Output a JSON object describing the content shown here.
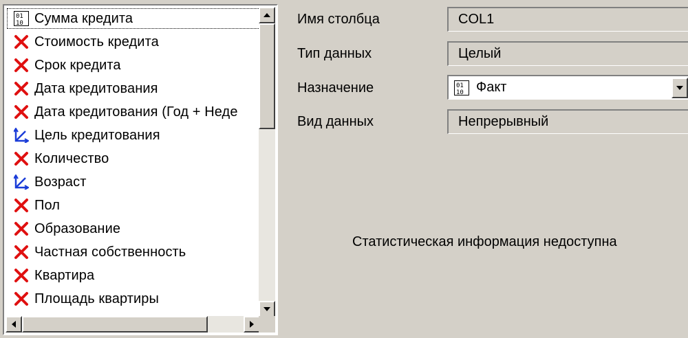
{
  "fields_list": {
    "items": [
      {
        "label": "Сумма кредита",
        "icon": "numeric-01-icon",
        "selected": true
      },
      {
        "label": "Стоимость кредита",
        "icon": "red-x-icon"
      },
      {
        "label": "Срок кредита",
        "icon": "red-x-icon"
      },
      {
        "label": "Дата кредитования",
        "icon": "red-x-icon"
      },
      {
        "label": "Дата кредитования (Год + Неде",
        "icon": "red-x-icon"
      },
      {
        "label": "Цель кредитования",
        "icon": "blue-axis-icon"
      },
      {
        "label": "Количество",
        "icon": "red-x-icon"
      },
      {
        "label": "Возраст",
        "icon": "blue-axis-icon"
      },
      {
        "label": "Пол",
        "icon": "red-x-icon"
      },
      {
        "label": "Образование",
        "icon": "red-x-icon"
      },
      {
        "label": "Частная собственность",
        "icon": "red-x-icon"
      },
      {
        "label": "Квартира",
        "icon": "red-x-icon"
      },
      {
        "label": "Площадь квартиры",
        "icon": "red-x-icon"
      }
    ]
  },
  "properties": {
    "column_name_label": "Имя столбца",
    "column_name_value": "COL1",
    "data_type_label": "Тип данных",
    "data_type_value": "Целый",
    "purpose_label": "Назначение",
    "purpose_value": "Факт",
    "kind_label": "Вид данных",
    "kind_value": "Непрерывный"
  },
  "status": {
    "stat_message": "Статистическая информация недоступна"
  },
  "colors": {
    "window_bg": "#d4d0c8",
    "red_icon": "#e01010",
    "blue_icon": "#1a3cd8"
  }
}
